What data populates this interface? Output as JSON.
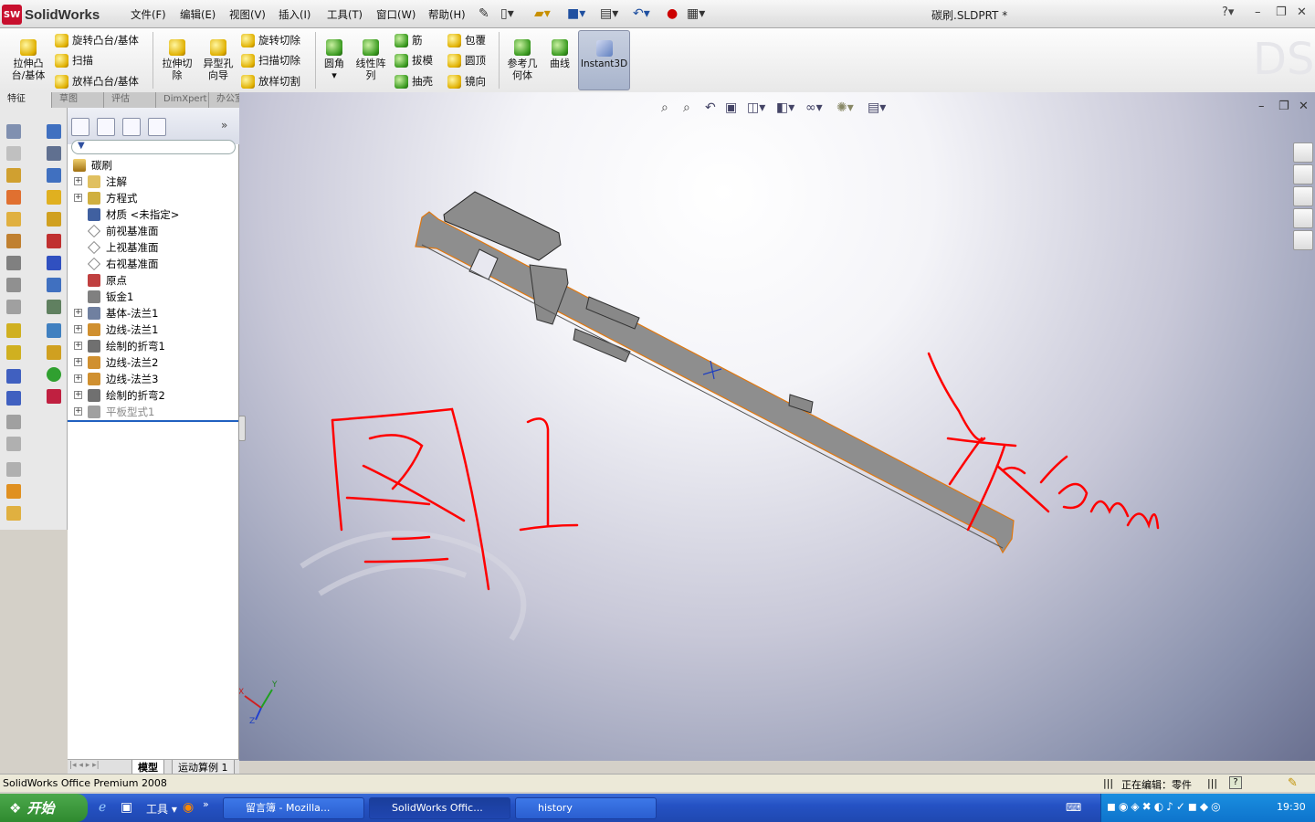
{
  "app": {
    "name": "SolidWorks",
    "logo_badge": "SW",
    "doc_title": "碳刷.SLDPRT *"
  },
  "menu": [
    "文件(F)",
    "编辑(E)",
    "视图(V)",
    "插入(I)",
    "工具(T)",
    "窗口(W)",
    "帮助(H)"
  ],
  "help_symbol": "?",
  "ribbon": {
    "extrude_boss": "拉伸凸\n台/基体",
    "revolve_boss": "旋转凸台/基体",
    "sweep": "扫描",
    "loft_boss": "放样凸台/基体",
    "extrude_cut": "拉伸切\n除",
    "hole_wizard": "异型孔\n向导",
    "revolve_cut": "旋转切除",
    "sweep_cut": "扫描切除",
    "loft_cut": "放样切割",
    "fillet": "圆角",
    "linear_pattern": "线性阵\n列",
    "rib": "筋",
    "draft": "拔模",
    "shell": "抽壳",
    "wrap": "包覆",
    "dome": "圆顶",
    "mirror": "镜向",
    "ref_geometry": "参考几\n何体",
    "curves": "曲线",
    "instant3d": "Instant3D"
  },
  "command_tabs": [
    "特征",
    "草图",
    "评估",
    "DimXpert",
    "办公室产品"
  ],
  "tree": {
    "root": "碳刷",
    "nodes": [
      {
        "label": "注解",
        "exp": true,
        "icon": "annotation-icon"
      },
      {
        "label": "方程式",
        "exp": true,
        "icon": "equation-icon"
      },
      {
        "label": "材质 <未指定>",
        "exp": false,
        "icon": "material-icon"
      },
      {
        "label": "前视基准面",
        "exp": false,
        "icon": "plane-icon"
      },
      {
        "label": "上视基准面",
        "exp": false,
        "icon": "plane-icon"
      },
      {
        "label": "右视基准面",
        "exp": false,
        "icon": "plane-icon"
      },
      {
        "label": "原点",
        "exp": false,
        "icon": "origin-icon"
      },
      {
        "label": "钣金1",
        "exp": false,
        "icon": "sheetmetal-icon"
      },
      {
        "label": "基体-法兰1",
        "exp": true,
        "icon": "base-flange-icon"
      },
      {
        "label": "边线-法兰1",
        "exp": true,
        "icon": "edge-flange-icon"
      },
      {
        "label": "绘制的折弯1",
        "exp": true,
        "icon": "sketched-bend-icon"
      },
      {
        "label": "边线-法兰2",
        "exp": true,
        "icon": "edge-flange-icon"
      },
      {
        "label": "边线-法兰3",
        "exp": true,
        "icon": "edge-flange-icon"
      },
      {
        "label": "绘制的折弯2",
        "exp": true,
        "icon": "sketched-bend-icon"
      },
      {
        "label": "平板型式1",
        "exp": true,
        "icon": "flat-pattern-icon",
        "dim": true
      }
    ],
    "bottom_tabs": [
      "模型",
      "运动算例 1"
    ]
  },
  "annotation": {
    "figure_label": "图 1",
    "dimension": "10mm"
  },
  "status": {
    "left": "SolidWorks Office Premium 2008",
    "editing": "正在编辑：零件"
  },
  "taskbar": {
    "start": "开始",
    "tools": "工具",
    "tasks": [
      "留言簿 - Mozilla...",
      "SolidWorks Offic...",
      "history"
    ],
    "clock": "19:30"
  },
  "colors": {
    "accent": "#c8102e",
    "part_gray": "#8c8c8c",
    "part_edge": "#e07810",
    "markup_red": "#ff0000"
  }
}
